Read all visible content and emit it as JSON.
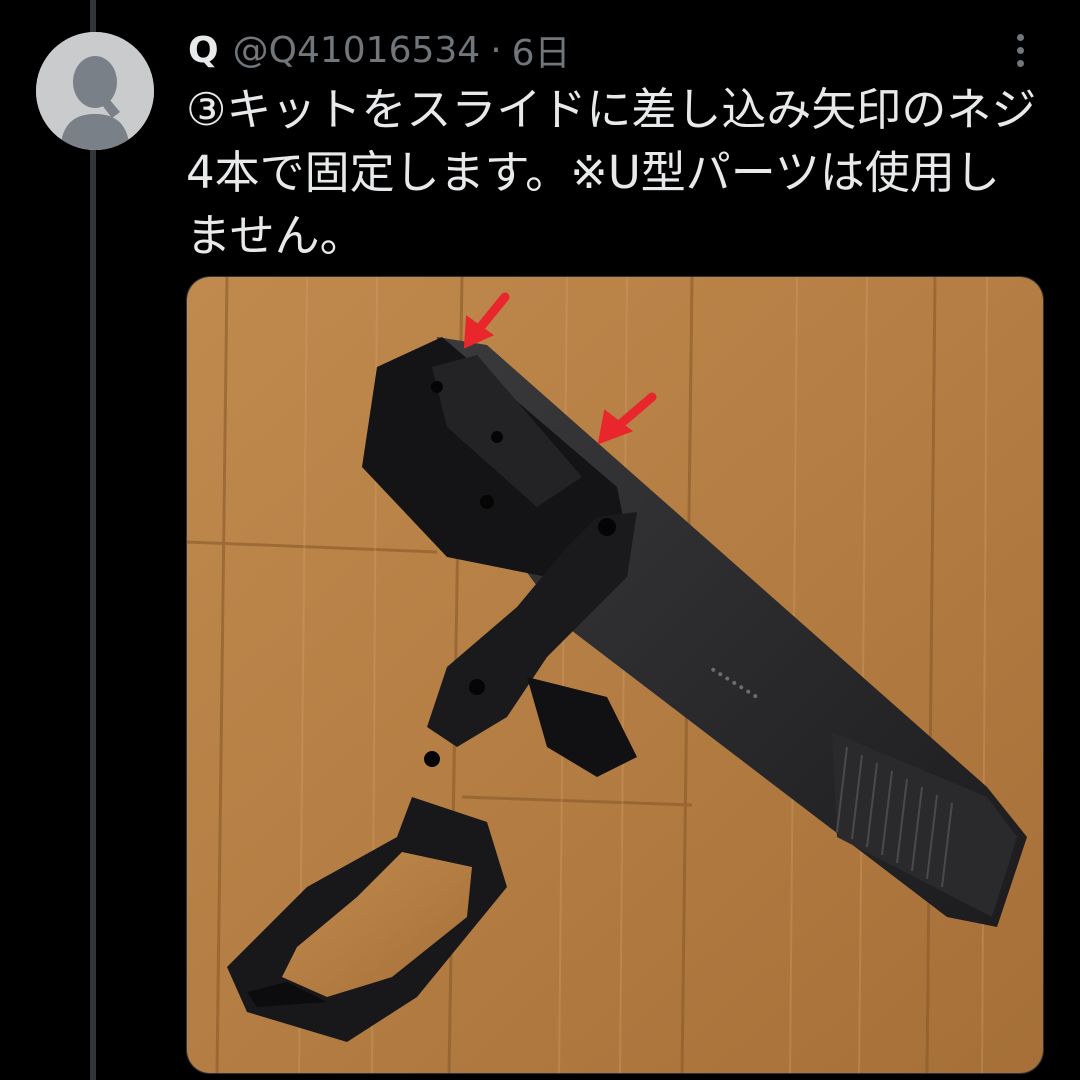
{
  "tweet": {
    "author": {
      "name": "Q",
      "handle": "@Q41016534",
      "separator": "·",
      "time": "6日"
    },
    "text": "③キットをスライドに差し込み矢印のネジ\n4本で固定します。※U型パーツは使用し\nません。",
    "media": {
      "description": "photo",
      "arrow_color": "#e8262c"
    }
  },
  "colors": {
    "background": "#000000",
    "text": "#e7e9ea",
    "muted": "#71767b",
    "thread_line": "#333639"
  }
}
